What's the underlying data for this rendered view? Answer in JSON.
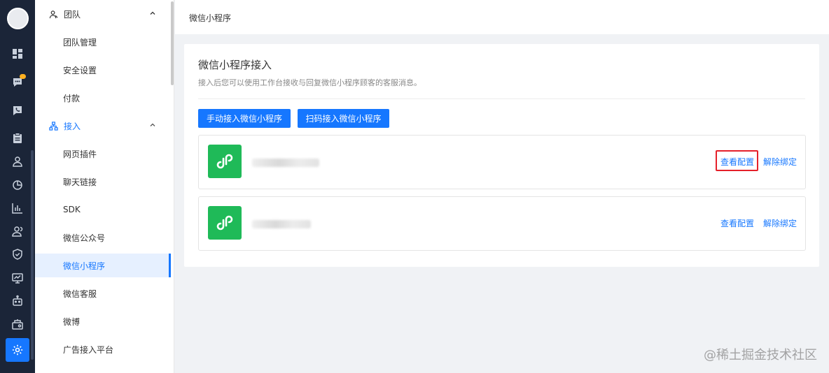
{
  "header": {
    "title": "微信小程序"
  },
  "rail": {
    "icons": [
      "dashboard-icon",
      "chat-icon",
      "phone-icon",
      "clipboard-icon",
      "user-icon",
      "pie-chart-icon",
      "bar-chart-icon",
      "team-icon",
      "shield-icon",
      "monitor-icon",
      "robot-icon",
      "store-icon",
      "gear-icon"
    ],
    "active": "gear-icon"
  },
  "sidebar": {
    "groups": [
      {
        "label": "团队",
        "items": [
          "团队管理",
          "安全设置",
          "付款"
        ]
      },
      {
        "label": "接入",
        "items": [
          "网页插件",
          "聊天链接",
          "SDK",
          "微信公众号",
          "微信小程序",
          "微信客服",
          "微博",
          "广告接入平台"
        ]
      }
    ],
    "active_item": "微信小程序"
  },
  "main": {
    "title": "微信小程序接入",
    "subtitle": "接入后您可以使用工作台接收与回复微信小程序顾客的客服消息。",
    "buttons": {
      "manual": "手动接入微信小程序",
      "scan": "扫码接入微信小程序"
    },
    "mini_programs": [
      {
        "view_config": "查看配置",
        "unbind": "解除绑定",
        "highlighted": true
      },
      {
        "view_config": "查看配置",
        "unbind": "解除绑定",
        "highlighted": false
      }
    ]
  },
  "colors": {
    "primary": "#1677ff",
    "rail_bg": "#1b2538",
    "mp_green": "#1fba58",
    "highlight_red": "#e5202a"
  },
  "watermark": "@稀土掘金技术社区"
}
